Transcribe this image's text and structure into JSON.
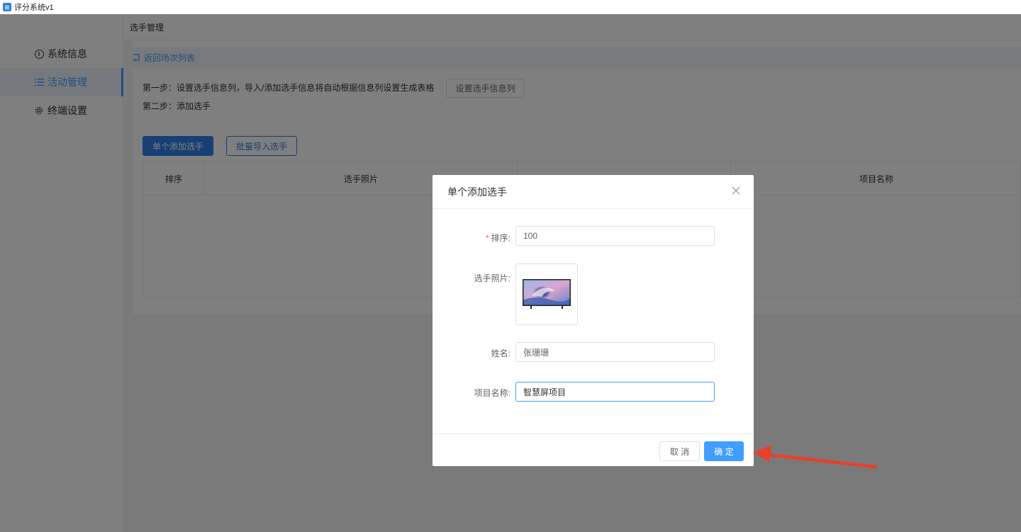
{
  "window": {
    "title": "评分系统v1",
    "icon": "app-list-icon"
  },
  "sidebar": {
    "items": [
      {
        "label": "系统信息",
        "icon": "info-circle-icon",
        "active": false
      },
      {
        "label": "活动管理",
        "icon": "list-icon",
        "active": true
      },
      {
        "label": "终端设置",
        "icon": "gear-icon",
        "active": false
      }
    ]
  },
  "page": {
    "breadcrumb": "选手管理",
    "back_link": "返回场次列表",
    "step1": "第一步：设置选手信息列，导入/添加选手信息将自动根据信息列设置生成表格",
    "step1_button": "设置选手信息列",
    "step2": "第二步：添加选手",
    "add_single_button": "单个添加选手",
    "batch_import_button": "批量导入选手"
  },
  "table": {
    "columns": [
      "排序",
      "选手照片",
      "",
      "项目名称"
    ]
  },
  "dialog": {
    "title": "单个添加选手",
    "fields": {
      "order": {
        "label": "排序:",
        "required": true,
        "value": "100"
      },
      "photo": {
        "label": "选手照片:"
      },
      "name": {
        "label": "姓名:",
        "value": "张珊珊"
      },
      "project": {
        "label": "项目名称:",
        "value": "智慧屏项目"
      }
    },
    "cancel_label": "取 消",
    "ok_label": "确 定"
  },
  "colors": {
    "primary": "#409eff",
    "primary_dark": "#2f7fe8",
    "annotation_arrow": "#e8402b"
  }
}
